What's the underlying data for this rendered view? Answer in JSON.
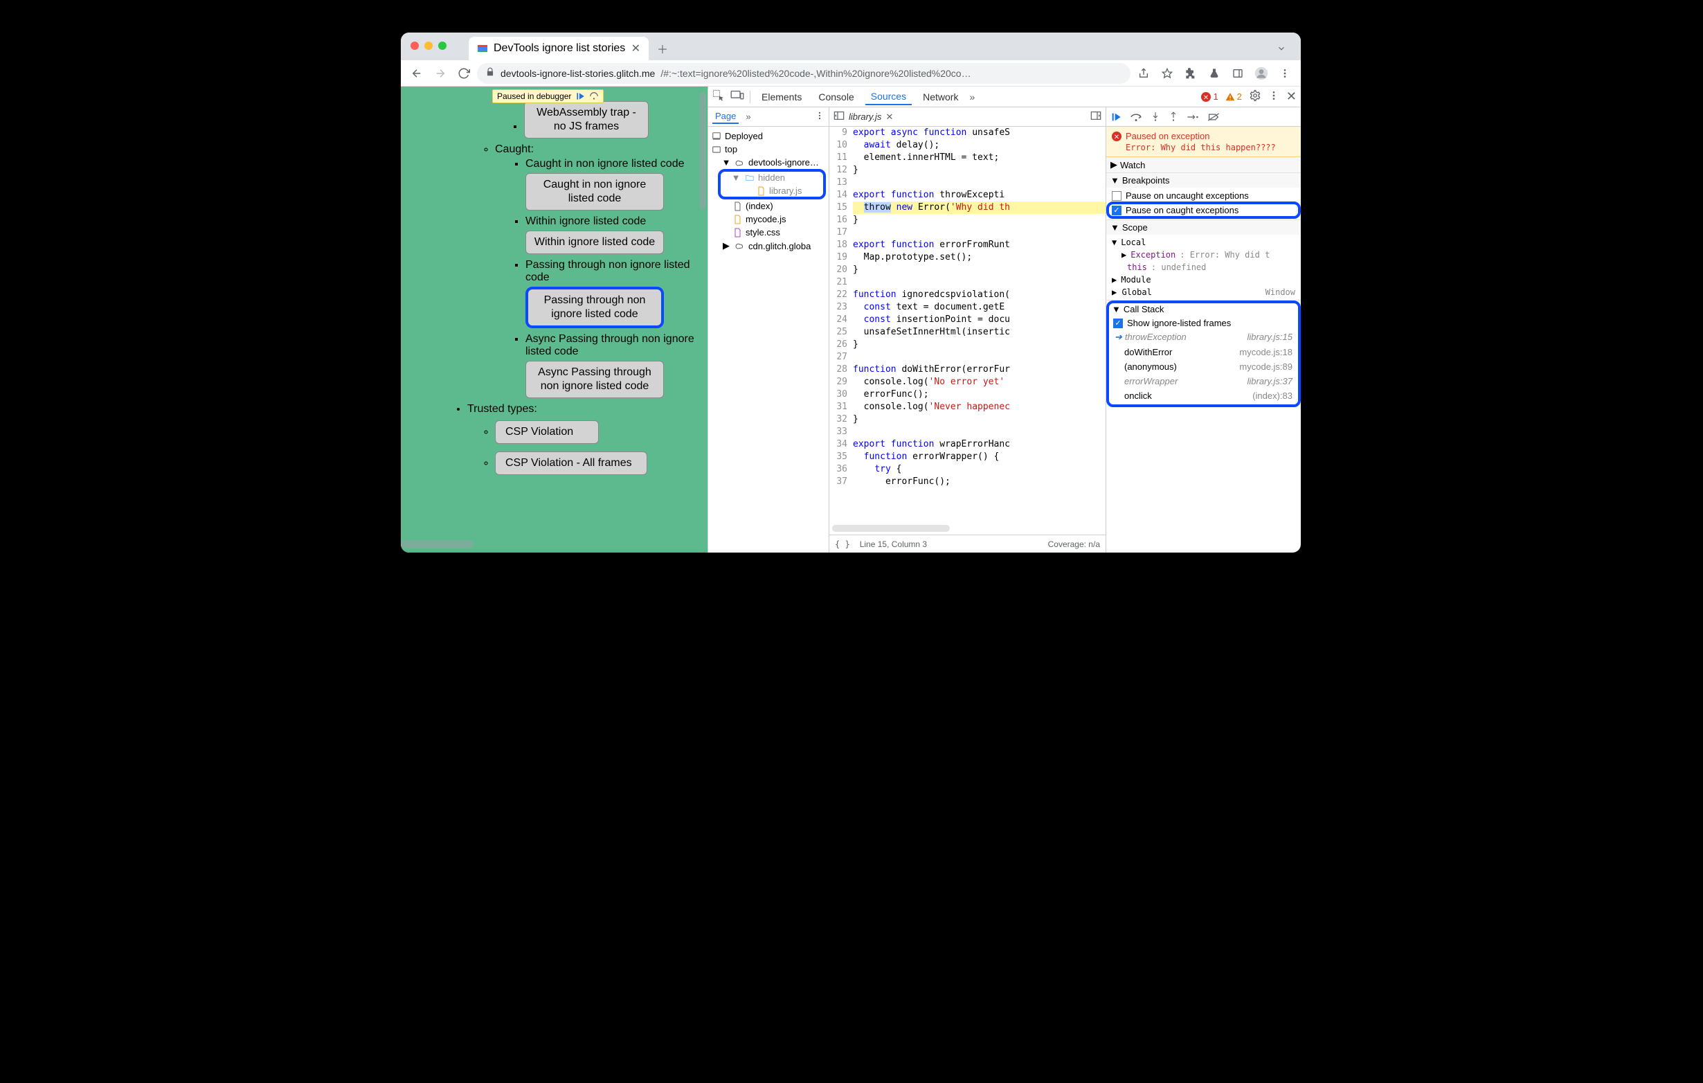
{
  "browser": {
    "tab_title": "DevTools ignore list stories",
    "url_host": "devtools-ignore-list-stories.glitch.me",
    "url_path": "/#:~:text=ignore%20listed%20code-,Within%20ignore%20listed%20co…"
  },
  "paused_badge": "Paused in debugger",
  "page_content": {
    "btn_top": "WebAssembly trap - no JS frames",
    "h_caught": "Caught:",
    "li1": "Caught in non ignore listed code",
    "btn1": "Caught in non ignore listed code",
    "li2": "Within ignore listed code",
    "btn2": "Within ignore listed code",
    "li3": "Passing through non ignore listed code",
    "btn3": "Passing through non ignore listed code",
    "li4": "Async Passing through non ignore listed code",
    "btn4": "Async Passing through non ignore listed code",
    "h_trusted": "Trusted types:",
    "btn5": "CSP Violation",
    "btn6": "CSP Violation - All frames"
  },
  "devtools": {
    "panels": {
      "elements": "Elements",
      "console": "Console",
      "sources": "Sources",
      "network": "Network"
    },
    "err_count": "1",
    "warn_count": "2",
    "nav": {
      "page": "Page",
      "deployed": "Deployed",
      "top": "top",
      "domain": "devtools-ignore…",
      "hidden": "hidden",
      "libraryjs": "library.js",
      "index": "(index)",
      "mycode": "mycode.js",
      "stylecss": "style.css",
      "cdn": "cdn.glitch.globa"
    },
    "editor": {
      "filename": "library.js",
      "lines": [
        {
          "n": 9,
          "html": "<span class='k-blue'>export</span> <span class='k-blue'>async</span> <span class='k-blue'>function</span> unsafeS"
        },
        {
          "n": 10,
          "html": "  <span class='k-blue'>await</span> delay();"
        },
        {
          "n": 11,
          "html": "  element.innerHTML = text;"
        },
        {
          "n": 12,
          "html": "}"
        },
        {
          "n": 13,
          "html": ""
        },
        {
          "n": 14,
          "html": "<span class='k-blue'>export</span> <span class='k-blue'>function</span> throwExcepti"
        },
        {
          "n": 15,
          "paused": true,
          "html": "  <span class='sel'>throw</span> <span class='k-blue'>new</span> <span class In474'>Error</span>(<span class='k-str'>'Why did th</span>"
        },
        {
          "n": 16,
          "html": "}"
        },
        {
          "n": 17,
          "html": ""
        },
        {
          "n": 18,
          "html": "<span class='k-blue'>export</span> <span class='k-blue'>function</span> errorFromRunt"
        },
        {
          "n": 19,
          "html": "  Map.prototype.set();"
        },
        {
          "n": 20,
          "html": "}"
        },
        {
          "n": 21,
          "html": ""
        },
        {
          "n": 22,
          "html": "<span class='k-blue'>function</span> ignoredcspviolation("
        },
        {
          "n": 23,
          "html": "  <span class='k-blue'>const</span> text = document.getE"
        },
        {
          "n": 24,
          "html": "  <span class='k-blue'>const</span> insertionPoint = docu"
        },
        {
          "n": 25,
          "html": "  unsafeSetInnerHtml(insertic"
        },
        {
          "n": 26,
          "html": "}"
        },
        {
          "n": 27,
          "html": ""
        },
        {
          "n": 28,
          "html": "<span class='k-blue'>function</span> doWithError(errorFur"
        },
        {
          "n": 29,
          "html": "  console.log(<span class='k-str'>'No error yet'</span>"
        },
        {
          "n": 30,
          "html": "  errorFunc();"
        },
        {
          "n": 31,
          "html": "  console.log(<span class='k-str'>'Never happenec</span>"
        },
        {
          "n": 32,
          "html": "}"
        },
        {
          "n": 33,
          "html": ""
        },
        {
          "n": 34,
          "html": "<span class='k-blue'>export</span> <span class='k-blue'>function</span> wrapErrorHanc"
        },
        {
          "n": 35,
          "html": "  <span class='k-blue'>function</span> errorWrapper() {"
        },
        {
          "n": 36,
          "html": "    <span class='k-blue'>try</span> {"
        },
        {
          "n": 37,
          "html": "      errorFunc();"
        }
      ],
      "footer_left": "Line 15, Column 3",
      "footer_right": "Coverage: n/a"
    },
    "paused": {
      "title": "Paused on exception",
      "msg": "Error: Why did this happen????"
    },
    "sections": {
      "watch": "Watch",
      "breakpoints": "Breakpoints",
      "bk1": "Pause on uncaught exceptions",
      "bk2": "Pause on caught exceptions",
      "scope": "Scope",
      "local": "Local",
      "exc": "Exception",
      "exc_v": ": Error: Why did t",
      "this": "this",
      "this_v": ": undefined",
      "module": "Module",
      "global": "Global",
      "global_v": "Window",
      "callstack": "Call Stack",
      "show_ig": "Show ignore-listed frames"
    },
    "frames": [
      {
        "fn": "throwException",
        "loc": "library.js:15",
        "ig": true,
        "cur": true
      },
      {
        "fn": "doWithError",
        "loc": "mycode.js:18",
        "ig": false
      },
      {
        "fn": "(anonymous)",
        "loc": "mycode.js:89",
        "ig": false
      },
      {
        "fn": "errorWrapper",
        "loc": "library.js:37",
        "ig": true
      },
      {
        "fn": "onclick",
        "loc": "(index):83",
        "ig": false
      }
    ]
  }
}
